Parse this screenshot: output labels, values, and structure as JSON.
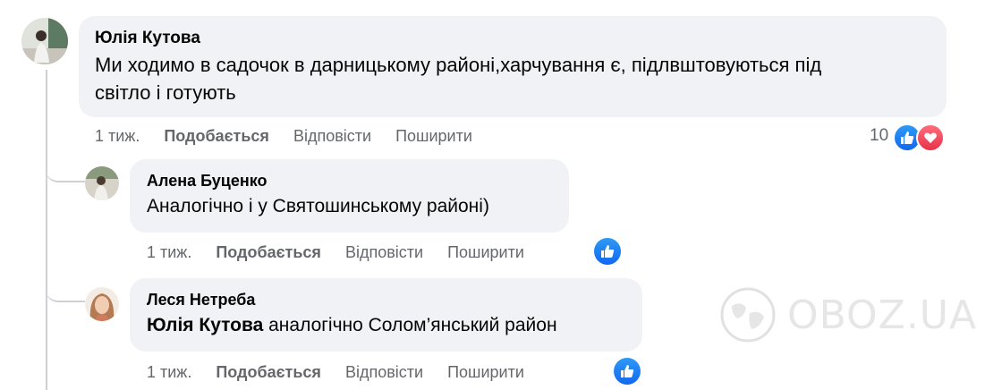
{
  "comment_main": {
    "author": "Юлія Кутова",
    "text_line1": "Ми ходимо в садочок в дарницькому районі,харчування є, підлвштовуються під",
    "text_line2": "світло і готують",
    "time": "1 тиж.",
    "like_label": "Подобається",
    "reply_label": "Відповісти",
    "share_label": "Поширити",
    "reaction_count": "10",
    "reactions": [
      "like-icon",
      "love-icon"
    ]
  },
  "reply_1": {
    "author": "Алена Буценко",
    "text": "Аналогічно і у Святошинському районі)",
    "time": "1 тиж.",
    "like_label": "Подобається",
    "reply_label": "Відповісти",
    "share_label": "Поширити",
    "reactions": [
      "like-icon"
    ]
  },
  "reply_2": {
    "author": "Леся Нетреба",
    "mention": "Юлія Кутова",
    "text": " аналогічно Солом’янський район",
    "time": "1 тиж.",
    "like_label": "Подобається",
    "reply_label": "Відповісти",
    "share_label": "Поширити",
    "reactions": [
      "like-icon"
    ]
  },
  "watermark": "OBOZ.UA",
  "colors": {
    "bubble": "#f0f2f5",
    "meta_text": "#65676b",
    "like_blue": "#1877f2",
    "love_red": "#f33e58",
    "thread_line": "#ced0d4"
  }
}
